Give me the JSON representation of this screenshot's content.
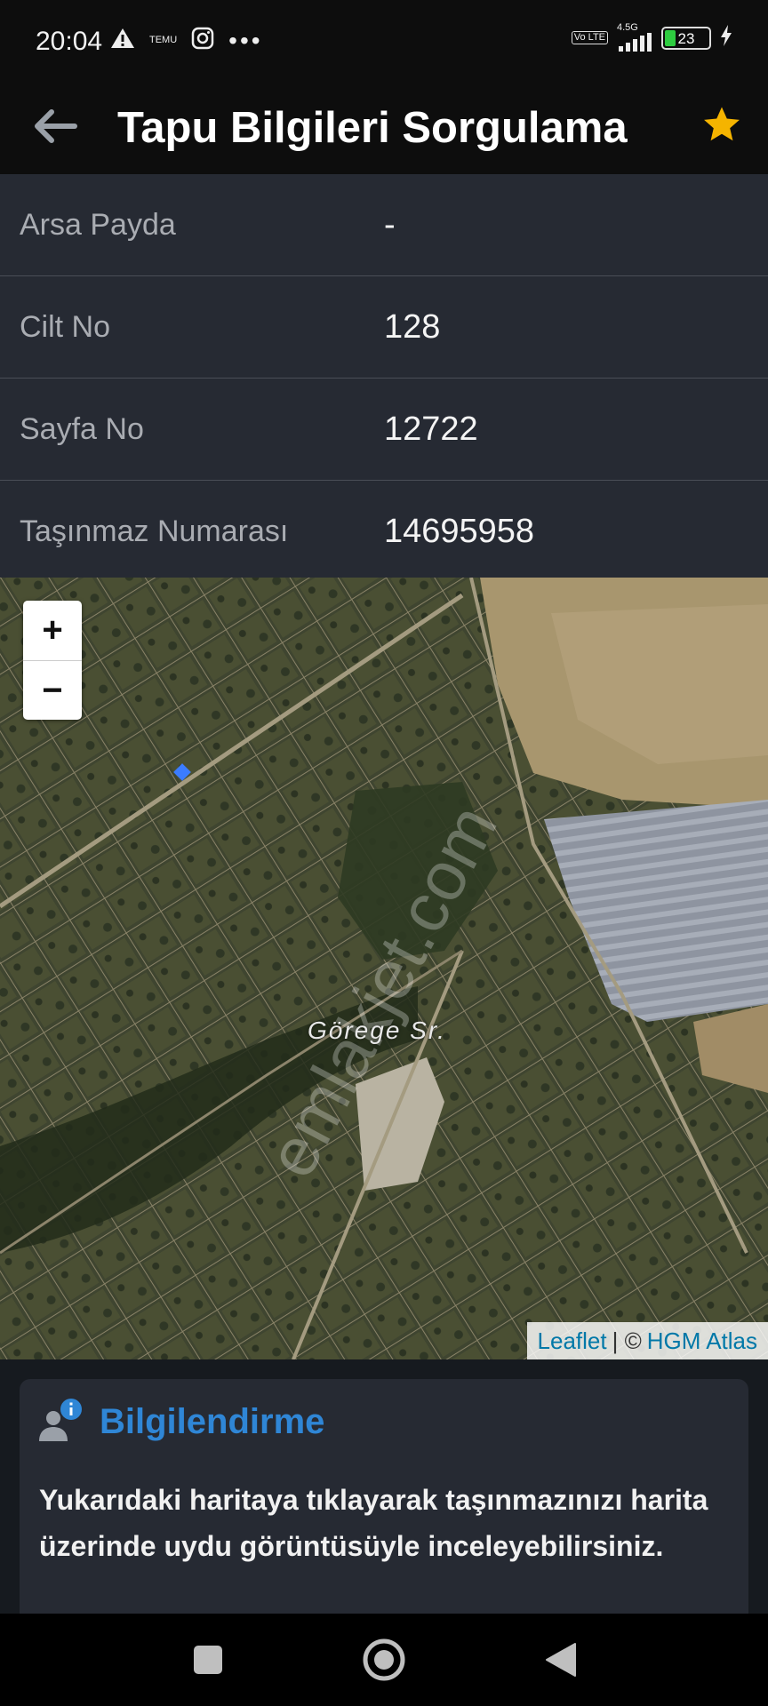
{
  "status_bar": {
    "time": "20:04",
    "temu_label": "TEMU",
    "more": "•••",
    "network": "4.5G",
    "volte": "Vo LTE",
    "battery": "23"
  },
  "header": {
    "title": "Tapu Bilgileri Sorgulama"
  },
  "info_rows": [
    {
      "label": "Arsa Payda",
      "value": "-"
    },
    {
      "label": "Cilt No",
      "value": "128"
    },
    {
      "label": "Sayfa No",
      "value": "12722"
    },
    {
      "label": "Taşınmaz Numarası",
      "value": "14695958"
    }
  ],
  "map": {
    "zoom_in": "+",
    "zoom_out": "−",
    "place_label": "Görege Sr.",
    "watermark": "emlakjet.com",
    "attribution": {
      "leaflet": "Leaflet",
      "separator": "| ©",
      "provider": "HGM Atlas"
    }
  },
  "info_card": {
    "title": "Bilgilendirme",
    "text": "Yukarıdaki haritaya tıklayarak taşınmazınızı harita üzerinde uydu görüntüsüyle inceleyebilirsiniz."
  },
  "colors": {
    "accent": "#2f86d6",
    "star": "#f5b400",
    "row_bg": "#262a33"
  },
  "icons": [
    "back-arrow-icon",
    "star-icon",
    "info-user-icon",
    "square-icon",
    "home-circle-icon",
    "back-triangle-icon"
  ]
}
